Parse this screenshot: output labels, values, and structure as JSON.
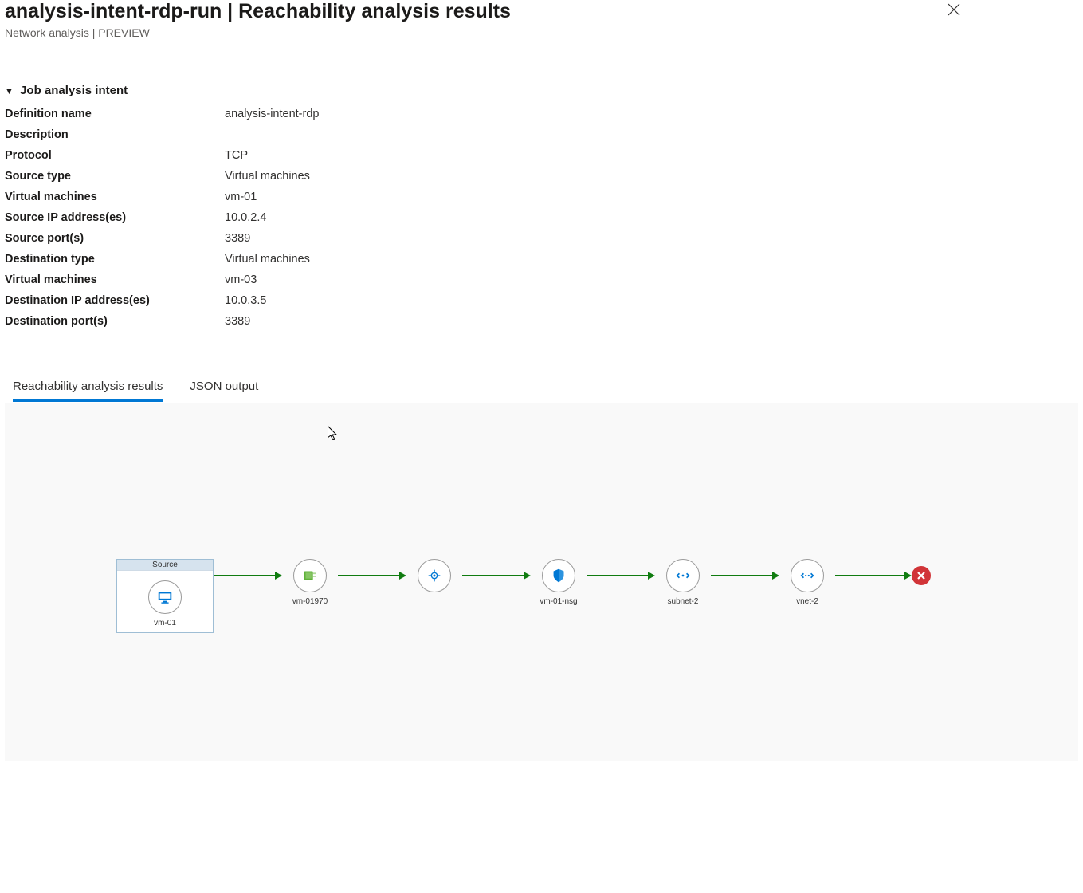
{
  "header": {
    "title": "analysis-intent-rdp-run | Reachability analysis results",
    "subtitle": "Network analysis | PREVIEW"
  },
  "section": {
    "title": "Job analysis intent"
  },
  "details": {
    "definition_name_label": "Definition name",
    "definition_name_value": "analysis-intent-rdp",
    "description_label": "Description",
    "description_value": "",
    "protocol_label": "Protocol",
    "protocol_value": "TCP",
    "source_type_label": "Source type",
    "source_type_value": "Virtual machines",
    "source_vm_label": "Virtual machines",
    "source_vm_value": "vm-01",
    "source_ip_label": "Source IP address(es)",
    "source_ip_value": "10.0.2.4",
    "source_port_label": "Source port(s)",
    "source_port_value": "3389",
    "dest_type_label": "Destination type",
    "dest_type_value": "Virtual machines",
    "dest_vm_label": "Virtual machines",
    "dest_vm_value": "vm-03",
    "dest_ip_label": "Destination IP address(es)",
    "dest_ip_value": "10.0.3.5",
    "dest_port_label": "Destination port(s)",
    "dest_port_value": "3389"
  },
  "tabs": {
    "results": "Reachability analysis results",
    "json": "JSON output"
  },
  "path": {
    "source_box_title": "Source",
    "nodes": {
      "n0": "vm-01",
      "n1": "vm-01970",
      "n2": "",
      "n3": "vm-01-nsg",
      "n4": "subnet-2",
      "n5": "vnet-2"
    }
  }
}
